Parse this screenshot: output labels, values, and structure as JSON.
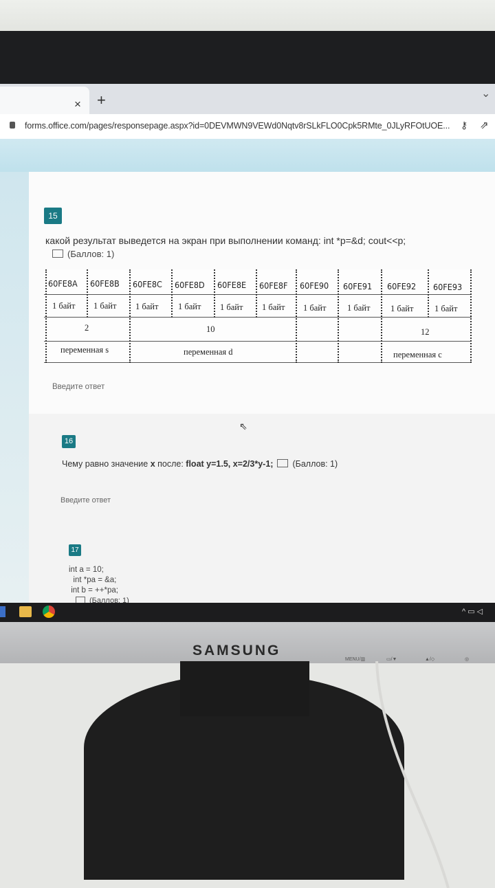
{
  "browser": {
    "tab_close": "×",
    "new_tab": "+",
    "url": "forms.office.com/pages/responsepage.aspx?id=0DEVMWN9VEWd0Nqtv8rSLkFLO0Cpk5RMte_0JLyRFOtUOE..."
  },
  "q15": {
    "number": "15",
    "text": "какой результат выведется на экран при выполнении команд:  int *p=&d; cout<<p;",
    "points": "(Баллов: 1)",
    "answer_placeholder": "Введите ответ",
    "addresses": [
      "60FE8A",
      "60FE8B",
      "60FE8C",
      "60FE8D",
      "60FE8E",
      "60FE8F",
      "60FE90",
      "60FE91",
      "60FE92",
      "60FE93"
    ],
    "byte_label": "1 байт",
    "values": [
      "2",
      "10",
      "12"
    ],
    "variables": [
      "переменная s",
      "переменная d",
      "переменная c"
    ]
  },
  "q16": {
    "number": "16",
    "text_prefix": "Чему равно значение ",
    "text_var": "x",
    "text_mid": " после: ",
    "text_code": "float y=1.5, x=2/3*y-1;",
    "points": "(Баллов: 1)",
    "answer_placeholder": "Введите ответ"
  },
  "q17": {
    "number": "17",
    "code_line1": "int a = 10;",
    "code_line2": "  int *pa = &a;",
    "code_line3": " int b = ++*pa;",
    "points": "(Баллов: 1)"
  },
  "monitor": {
    "brand": "SAMSUNG",
    "menu_label": "MENU/▥",
    "btn2_label": "▭/▼",
    "btn3_label": "▲/◇",
    "power_label": "◎"
  }
}
